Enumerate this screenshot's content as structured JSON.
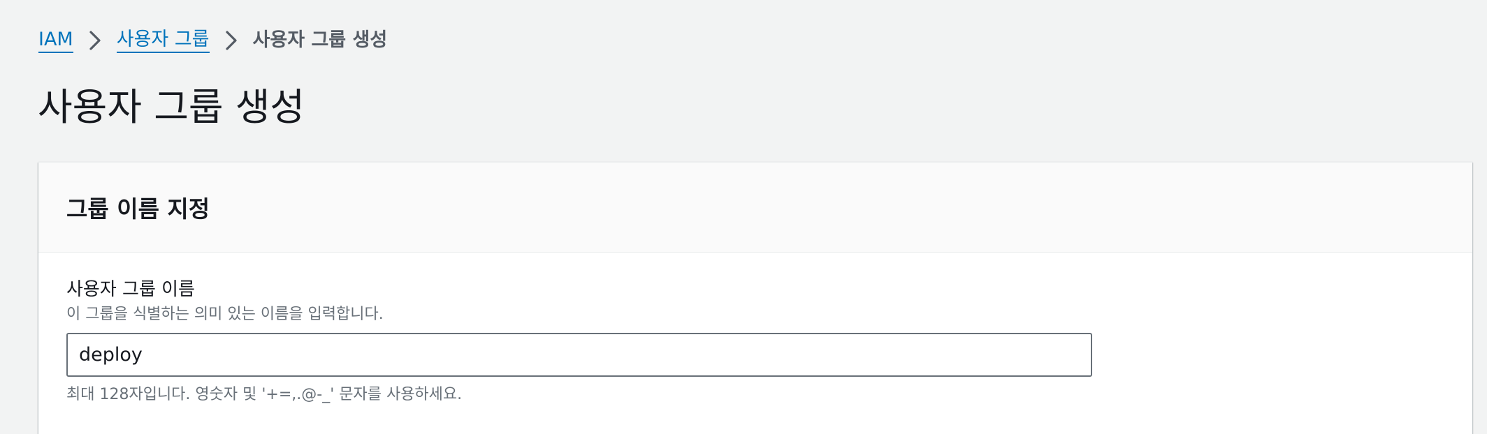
{
  "breadcrumb": {
    "items": [
      {
        "label": "IAM"
      },
      {
        "label": "사용자 그룹"
      },
      {
        "label": "사용자 그룹 생성"
      }
    ],
    "separator_icon": "chevron-right-icon"
  },
  "page": {
    "title": "사용자 그룹 생성"
  },
  "panel": {
    "title": "그룹 이름 지정",
    "field": {
      "label": "사용자 그룹 이름",
      "description": "이 그룹을 식별하는 의미 있는 이름을 입력합니다.",
      "value": "deploy",
      "constraint": "최대 128자입니다. 영숫자 및 '+=,.@-_' 문자를 사용하세요."
    }
  },
  "colors": {
    "link": "#0073bb",
    "background": "#f2f3f3",
    "text": "#16191f",
    "secondary_text": "#687078"
  }
}
